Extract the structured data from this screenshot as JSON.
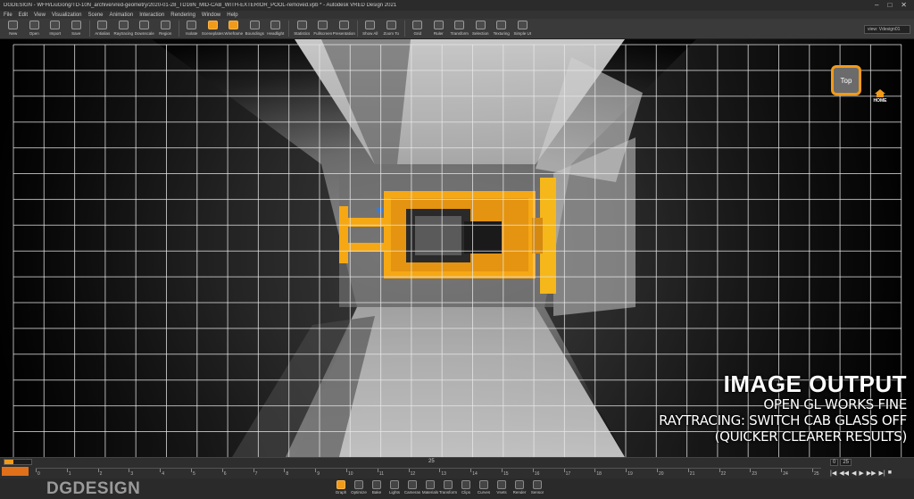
{
  "window": {
    "title": "DGDESIGN - WFH/LiuGong/TD-10N_archive/vred-geometry/2020-01-28_TD16N_MID-CAB_WITH-EXTERIOR_POOL-removed.vpb * - Autodesk VRED Design 2021",
    "controls": {
      "minimize": "–",
      "maximize": "□",
      "close": "✕"
    }
  },
  "menu": [
    "File",
    "Edit",
    "View",
    "Visualization",
    "Scene",
    "Animation",
    "Interaction",
    "Rendering",
    "Window",
    "Help"
  ],
  "toolbar": [
    {
      "label": "New",
      "icon": "new-icon"
    },
    {
      "label": "Open",
      "icon": "open-icon"
    },
    {
      "label": "Import",
      "icon": "import-icon"
    },
    {
      "label": "Save",
      "icon": "save-icon"
    },
    {
      "label": "Antialias",
      "icon": "antialias-icon"
    },
    {
      "label": "Raytracing",
      "icon": "raytracing-icon"
    },
    {
      "label": "Downscale",
      "icon": "downscale-icon"
    },
    {
      "label": "Region",
      "icon": "region-icon"
    },
    {
      "label": "Isolate",
      "icon": "isolate-icon"
    },
    {
      "label": "Sceneplates",
      "icon": "sceneplates-icon",
      "active": true
    },
    {
      "label": "Wireframe",
      "icon": "wireframe-icon",
      "active": true
    },
    {
      "label": "Boundings",
      "icon": "boundings-icon"
    },
    {
      "label": "Headlight",
      "icon": "headlight-icon"
    },
    {
      "label": "Statistics",
      "icon": "statistics-icon"
    },
    {
      "label": "Fullscreen",
      "icon": "fullscreen-icon"
    },
    {
      "label": "Presentation",
      "icon": "presentation-icon"
    },
    {
      "label": "Show All",
      "icon": "show-all-icon"
    },
    {
      "label": "Zoom To",
      "icon": "zoom-to-icon"
    },
    {
      "label": "Grid",
      "icon": "grid-icon"
    },
    {
      "label": "Ruler",
      "icon": "ruler-icon"
    },
    {
      "label": "Transform",
      "icon": "transform-icon"
    },
    {
      "label": "Selection",
      "icon": "selection-icon"
    },
    {
      "label": "Texturing",
      "icon": "texturing-icon"
    },
    {
      "label": "Simple UI",
      "icon": "simple-ui-icon"
    }
  ],
  "render_window_select": "view: Vdesign01",
  "navcube": {
    "label": "Top"
  },
  "home": {
    "label": "HOME"
  },
  "overlay": {
    "heading": "IMAGE OUTPUT",
    "lines": [
      "OPEN GL WORKS FINE",
      "RAYTRACING: SWITCH CAB GLASS OFF",
      "(QUICKER CLEARER RESULTS)"
    ]
  },
  "timeline": {
    "current_frame": "25",
    "start_value": "0",
    "end_value": "25",
    "ticks": [
      "0",
      "1",
      "2",
      "3",
      "4",
      "5",
      "6",
      "7",
      "8",
      "9",
      "10",
      "11",
      "12",
      "13",
      "14",
      "15",
      "16",
      "17",
      "18",
      "19",
      "20",
      "21",
      "22",
      "23",
      "24",
      "25"
    ],
    "controls": [
      "|◀",
      "◀◀",
      "◀",
      "▶",
      "▶▶",
      "▶|",
      "■"
    ]
  },
  "brand": {
    "logo_text": "DGDESIGN"
  },
  "dock": [
    {
      "label": "Graph",
      "icon": "graph-icon",
      "active": true
    },
    {
      "label": "Optimize",
      "icon": "optimize-icon"
    },
    {
      "label": "Bake",
      "icon": "bake-icon"
    },
    {
      "label": "Lights",
      "icon": "lights-icon"
    },
    {
      "label": "Cameras",
      "icon": "cameras-icon"
    },
    {
      "label": "Materials",
      "icon": "materials-icon"
    },
    {
      "label": "Transform",
      "icon": "transform-icon"
    },
    {
      "label": "Clips",
      "icon": "clips-icon"
    },
    {
      "label": "Curves",
      "icon": "curves-icon"
    },
    {
      "label": "Vsets",
      "icon": "vsets-icon"
    },
    {
      "label": "Render",
      "icon": "render-icon"
    },
    {
      "label": "Sensor",
      "icon": "sensor-icon"
    }
  ],
  "colors": {
    "accent": "#f29a1a",
    "machine": "#f5a814",
    "grid": "#e8e8e8"
  }
}
